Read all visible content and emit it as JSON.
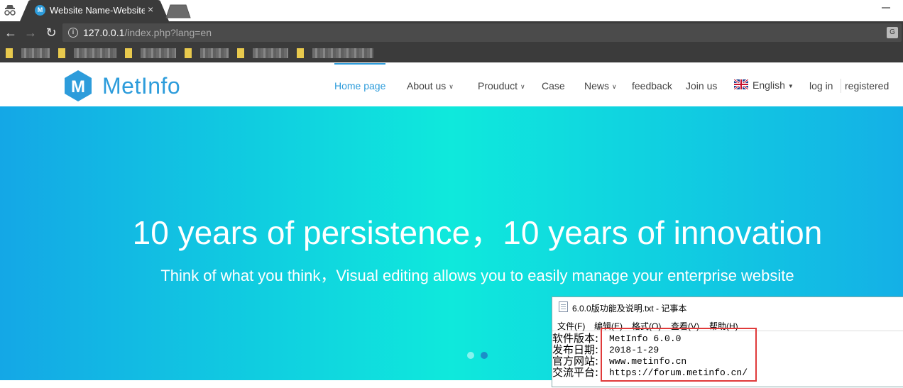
{
  "browser": {
    "tab_title": "Website Name-Website",
    "tab_close": "×",
    "favicon_letter": "M",
    "url_host": "127.0.0.1",
    "url_path": "/index.php?lang=en",
    "info_icon": "i",
    "translate_icon": "G"
  },
  "site": {
    "logo_text": "MetInfo",
    "logo_letter": "M",
    "brand_color": "#2d9cdb",
    "nav": {
      "home": "Home page",
      "about": "About us",
      "product": "Prouduct",
      "case": "Case",
      "news": "News",
      "feedback": "feedback",
      "join": "Join us",
      "language": "English",
      "login": "log in",
      "register": "registered"
    },
    "hero": {
      "title": "10 years of persistence，10 years of innovation",
      "subtitle": "Think of what you think，Visual editing allows you to easily manage your enterprise website"
    }
  },
  "notepad": {
    "title": "6.0.0版功能及说明.txt - 记事本",
    "menu": [
      "文件(F)",
      "编辑(E)",
      "格式(O)",
      "查看(V)",
      "帮助(H)"
    ],
    "labels": [
      "软件版本:",
      "发布日期:",
      "官方网站:",
      "交流平台:"
    ],
    "values": [
      "MetInfo 6.0.0",
      "2018-1-29",
      "www.metinfo.cn",
      "https://forum.metinfo.cn/"
    ]
  }
}
